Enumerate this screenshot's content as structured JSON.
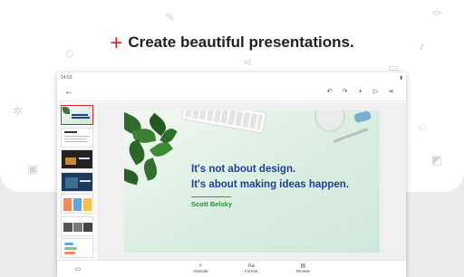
{
  "headline": {
    "plus": "+",
    "text": "Create beautiful presentations."
  },
  "status_bar": {
    "time": "14:53",
    "battery": "▮"
  },
  "toolbar": {
    "back": "←",
    "icons": [
      "↶",
      "↷",
      "+",
      "▷",
      "⋖"
    ]
  },
  "slide": {
    "quote_line_1": "It's not about design.",
    "quote_line_2": "It's about making ideas happen.",
    "author": "Scott Belsky"
  },
  "thumbnails": [
    "1",
    "2",
    "3",
    "4",
    "5",
    "6",
    "7"
  ],
  "bottom_bar": {
    "slides_icon": "▭",
    "animate": {
      "icon": "✧",
      "label": "Animate"
    },
    "format": {
      "icon": "Aa",
      "label": "Format"
    },
    "review": {
      "icon": "▤",
      "label": "Review"
    }
  },
  "colors": {
    "accent": "#e0282e",
    "quote_text": "#1f3f92",
    "author": "#2b8f45"
  }
}
